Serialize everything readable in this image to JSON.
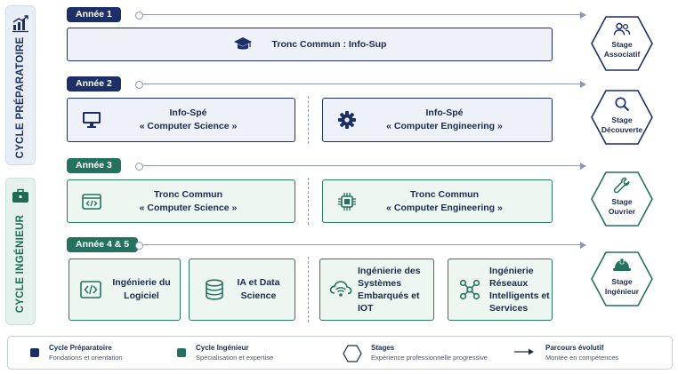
{
  "cycles": {
    "preparatory": {
      "label": "CYCLE PRÉPARATOIRE",
      "icon": "chart-icon"
    },
    "engineering": {
      "label": "CYCLE INGÉNIEUR",
      "icon": "briefcase-icon"
    }
  },
  "years": [
    {
      "label": "Année 1"
    },
    {
      "label": "Année 2"
    },
    {
      "label": "Année 3"
    },
    {
      "label": "Année 4 & 5"
    }
  ],
  "tracks": {
    "year1": {
      "label": "Tronc Commun : Info-Sup",
      "icon": "graduation-cap-icon"
    },
    "year2_cs": {
      "line1": "Info-Spé",
      "line2": "« Computer Science »",
      "icon": "monitor-icon"
    },
    "year2_ce": {
      "line1": "Info-Spé",
      "line2": "« Computer Engineering »",
      "icon": "gear-icon"
    },
    "year3_cs": {
      "line1": "Tronc Commun",
      "line2": "« Computer Science »",
      "icon": "code-window-icon"
    },
    "year3_ce": {
      "line1": "Tronc Commun",
      "line2": "« Computer Engineering »",
      "icon": "chip-icon"
    },
    "year45": [
      {
        "lines": [
          "Ingénierie du",
          "Logiciel"
        ],
        "icon": "code-icon"
      },
      {
        "lines": [
          "IA et Data",
          "Science"
        ],
        "icon": "database-icon"
      },
      {
        "lines": [
          "Ingénierie des",
          "Systèmes",
          "Embarqués et",
          "IOT"
        ],
        "icon": "cloud-iot-icon"
      },
      {
        "lines": [
          "Ingénierie",
          "Réseaux",
          "Intelligents et",
          "Services"
        ],
        "icon": "network-icon"
      }
    ]
  },
  "stages": [
    {
      "line1": "Stage",
      "line2": "Associatif",
      "icon": "users-icon"
    },
    {
      "line1": "Stage",
      "line2": "Découverte",
      "icon": "magnifier-icon"
    },
    {
      "line1": "Stage",
      "line2": "Ouvrier",
      "icon": "wrench-icon"
    },
    {
      "line1": "Stage",
      "line2": "Ingénieur",
      "icon": "hard-hat-icon"
    }
  ],
  "legend": {
    "prep": {
      "title": "Cycle Préparatoire",
      "sub": "Fondations et orientation"
    },
    "ing": {
      "title": "Cycle Ingénieur",
      "sub": "Spécialisation et expertise"
    },
    "stages": {
      "title": "Stages",
      "sub": "Expérience professionnelle progressive"
    },
    "path": {
      "title": "Parcours évolutif",
      "sub": "Montée en compétences"
    }
  },
  "colors": {
    "navy": "#1c2f66",
    "green": "#247160",
    "navy_fill": "#eef1f8",
    "green_fill": "#edf6f1"
  }
}
